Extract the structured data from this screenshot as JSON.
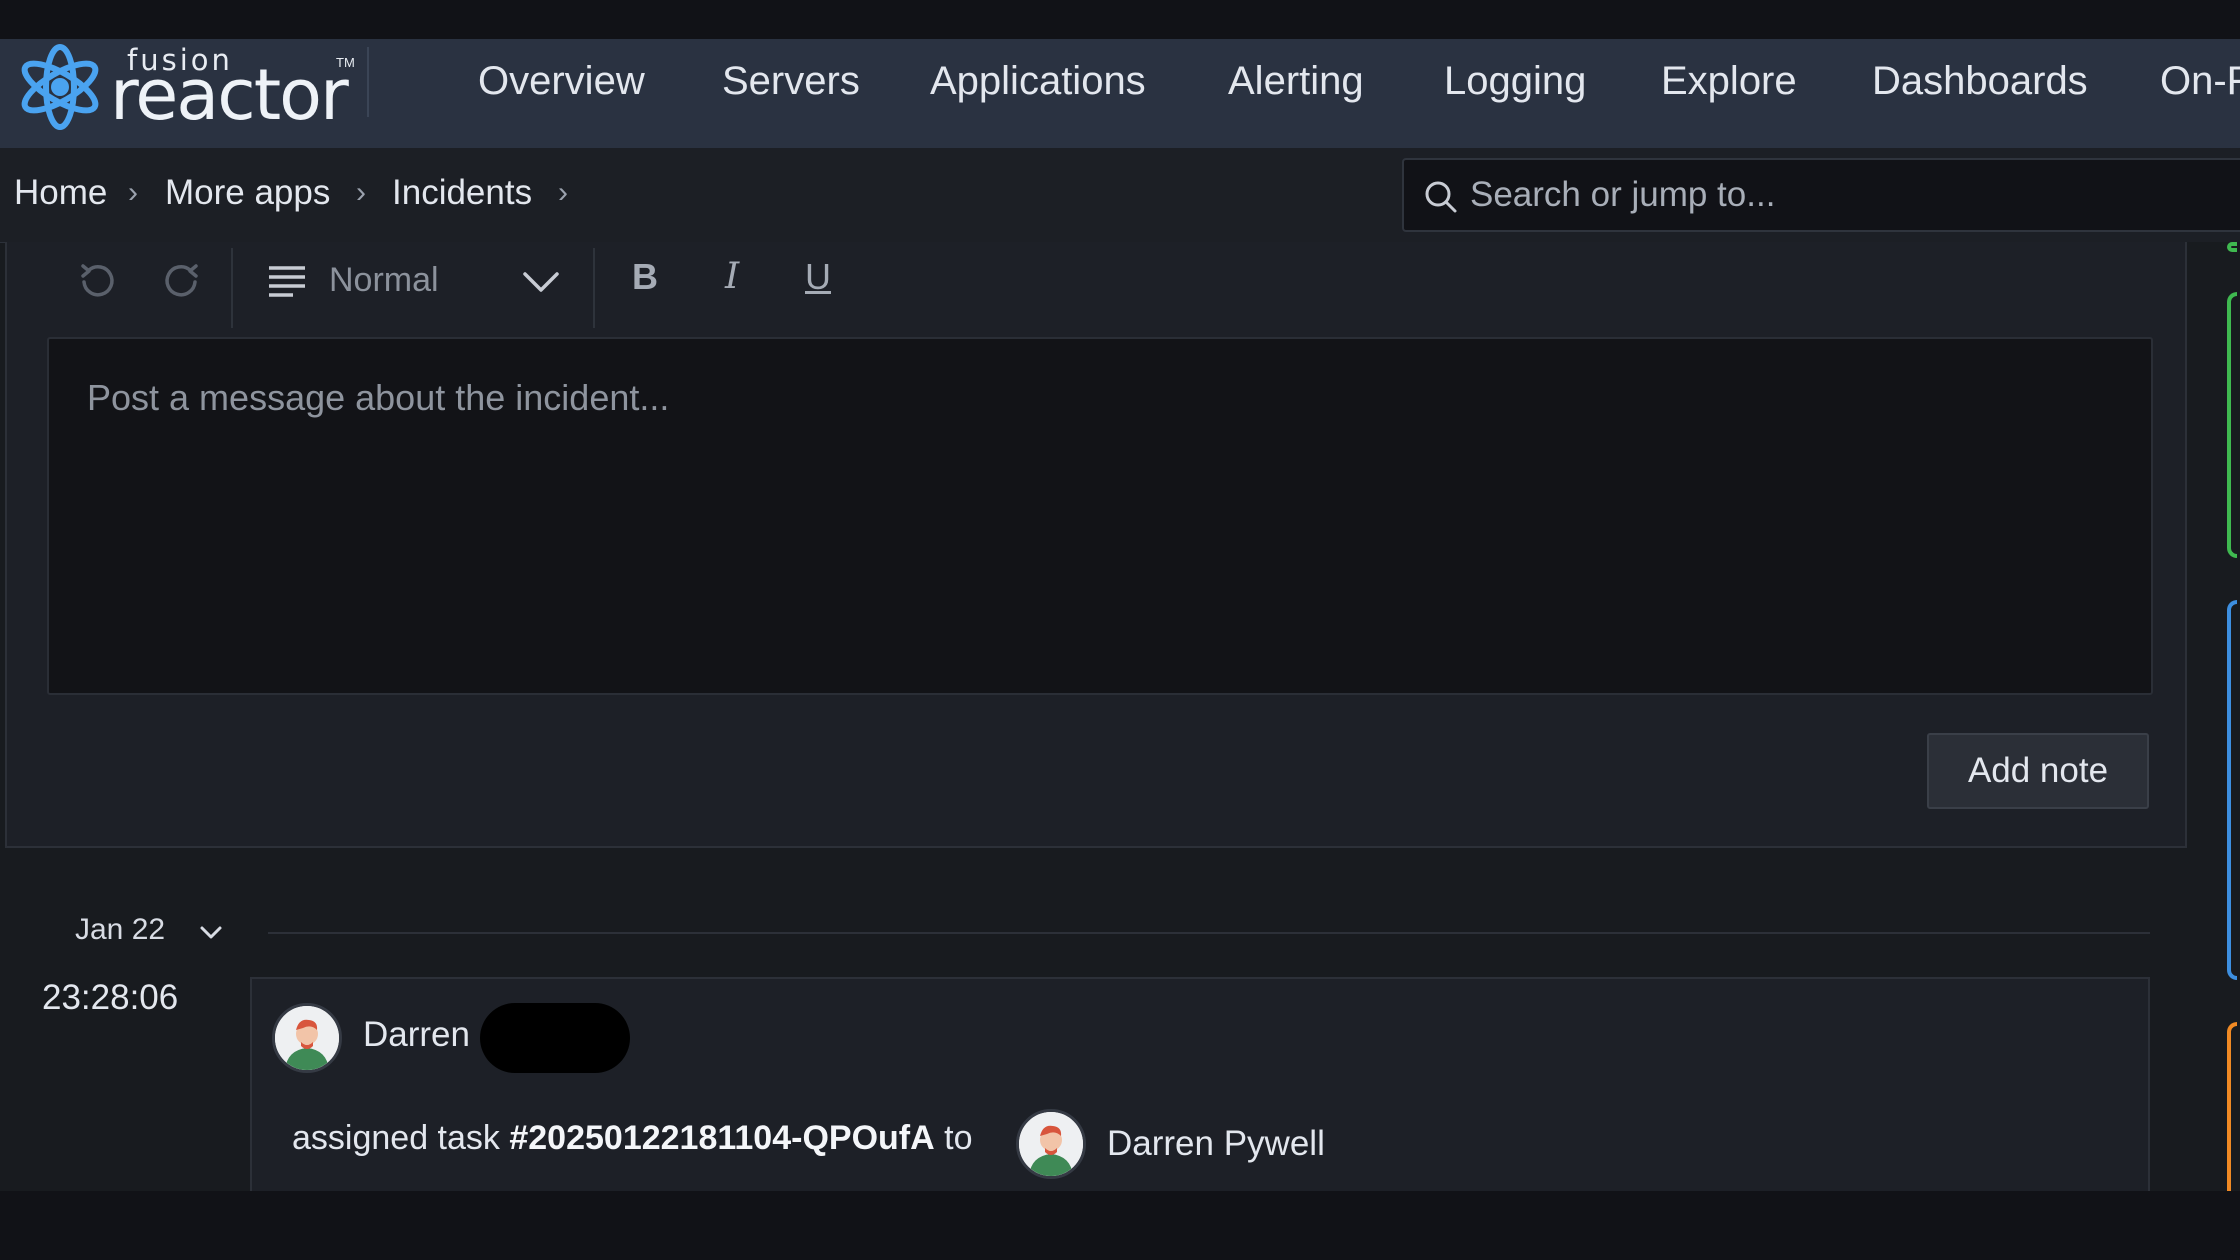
{
  "header": {
    "logo": {
      "word1": "fusion",
      "word2": "reactor",
      "tm": "TM"
    },
    "nav": [
      "Overview",
      "Servers",
      "Applications",
      "Alerting",
      "Logging",
      "Explore",
      "Dashboards",
      "On-F"
    ]
  },
  "breadcrumb": {
    "items": [
      "Home",
      "More apps",
      "Incidents"
    ],
    "separator": "›"
  },
  "search": {
    "placeholder": "Search or jump to..."
  },
  "editor": {
    "format": "Normal",
    "bold": "B",
    "italic": "I",
    "underline": "U",
    "placeholder": "Post a message about the incident...",
    "add_note": "Add note"
  },
  "timeline": {
    "date": "Jan 22",
    "time": "23:28:06",
    "actor": "Darren",
    "action_prefix": "assigned task ",
    "task_id": "#20250122181104-QPOufA",
    "action_suffix": " to",
    "assignee": "Darren Pywell"
  },
  "colors": {
    "nav_bg": "#2a3241",
    "page_bg": "#181b1f",
    "logo_blue": "#4aa3f0",
    "edge_green": "#3fb950",
    "edge_blue": "#3d8fe0",
    "edge_orange": "#f08a24"
  }
}
